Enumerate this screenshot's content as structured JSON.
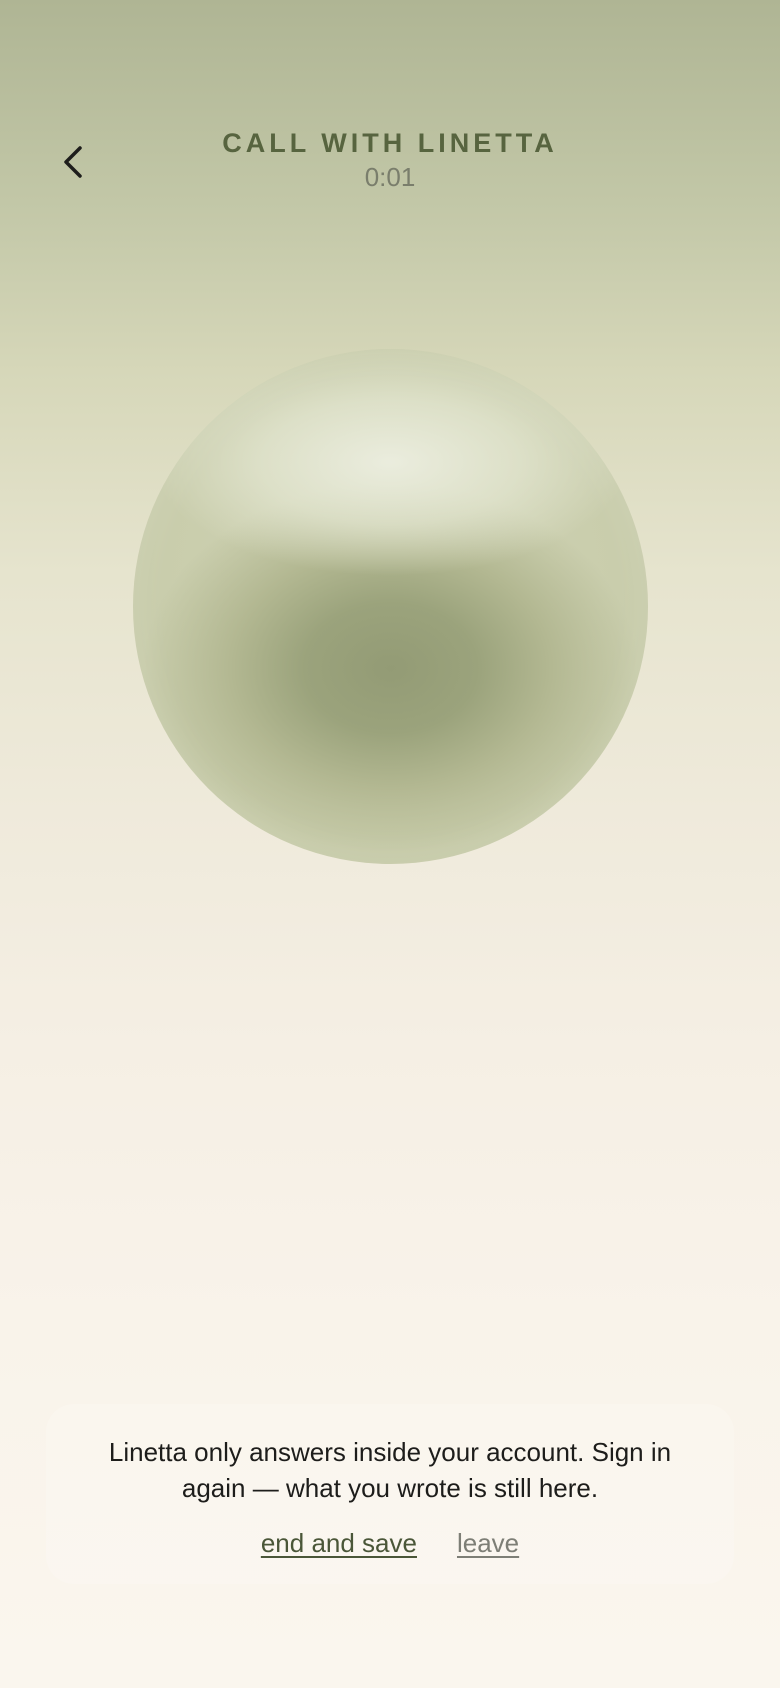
{
  "header": {
    "back_icon": "chevron-left-icon",
    "title": "CALL WITH LINETTA",
    "timer": "0:01"
  },
  "orb": {
    "colors": {
      "light": "#e3e6d3",
      "mid": "#c7cba9",
      "dark": "#939b75"
    }
  },
  "notice": {
    "message": "Linetta only answers inside your account. Sign in again — what you wrote is still here.",
    "end_and_save_label": "end and save",
    "leave_label": "leave"
  },
  "colors": {
    "title": "#57643f",
    "primary_link": "#4a5638",
    "secondary_link": "#7d7e76",
    "background_top": "#afb594",
    "background_bottom": "#faf6ee"
  }
}
